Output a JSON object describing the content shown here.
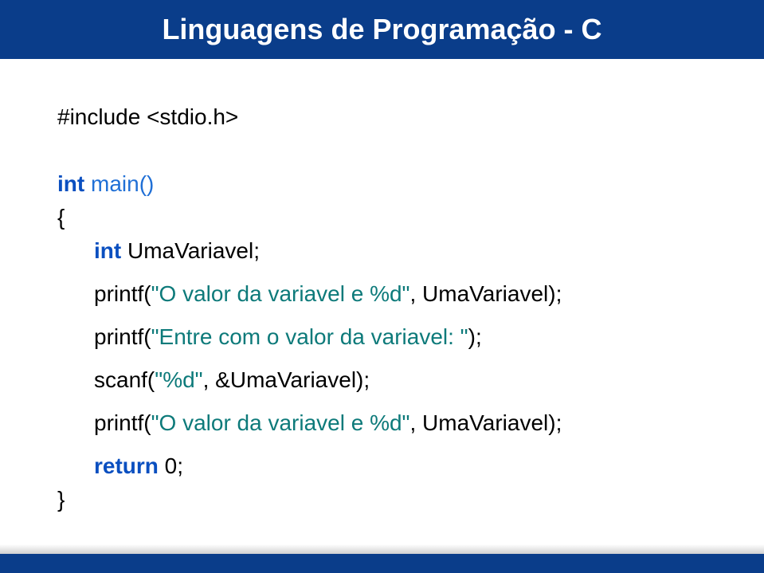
{
  "title": "Linguagens de Programação - C",
  "code": {
    "include": "#include <stdio.h>",
    "int_kw": "int",
    "main_sig": " main()",
    "open_brace": "{",
    "decl_var": " UmaVariavel;",
    "printf1_fn": "printf(",
    "printf1_str": "\"O valor da variavel e %d\"",
    "printf1_rest": ", UmaVariavel);",
    "printf2_fn": "printf(",
    "printf2_str": "\"Entre com o valor da variavel: \"",
    "printf2_rest": ");",
    "scanf_fn": "scanf(",
    "scanf_str": "\"%d\"",
    "scanf_rest": ", &UmaVariavel);",
    "printf3_fn": "printf(",
    "printf3_str": "\"O valor da variavel e %d\"",
    "printf3_rest": ", UmaVariavel);",
    "return_kw": "return",
    "return_rest": " 0;",
    "close_brace": "}"
  }
}
